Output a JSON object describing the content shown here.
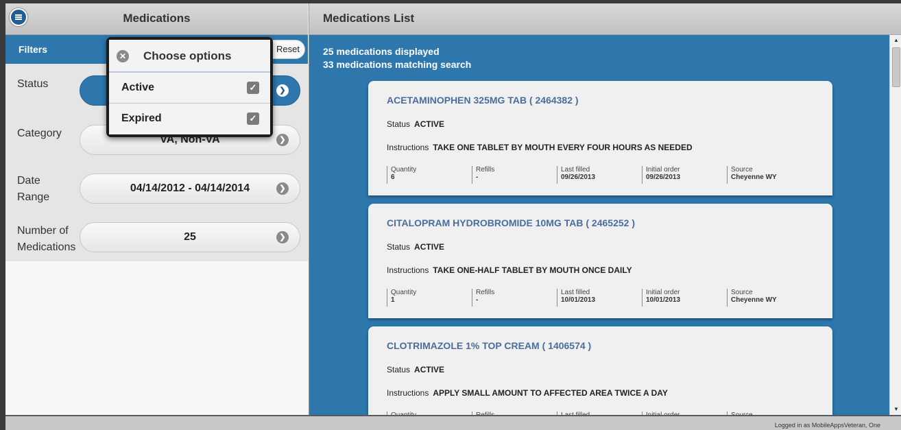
{
  "left_panel": {
    "title": "Medications",
    "filters_label": "Filters",
    "reset_label": "Reset",
    "filters": [
      {
        "label": "Status",
        "value": ""
      },
      {
        "label": "Category",
        "value": "VA, Non-VA"
      },
      {
        "label": "Date Range",
        "value": "04/14/2012 - 04/14/2014"
      },
      {
        "label": "Number of Medications",
        "value": "25"
      }
    ]
  },
  "popup": {
    "title": "Choose options",
    "options": [
      {
        "label": "Active",
        "checked": true
      },
      {
        "label": "Expired",
        "checked": true
      }
    ]
  },
  "right_panel": {
    "title": "Medications List",
    "displayed": "25 medications displayed",
    "matching": "33 medications matching search",
    "cards": [
      {
        "name": "ACETAMINOPHEN 325MG TAB ( 2464382 )",
        "status_label": "Status",
        "status": "ACTIVE",
        "instructions_label": "Instructions",
        "instructions": "TAKE ONE TABLET BY MOUTH EVERY FOUR HOURS AS NEEDED",
        "fields": [
          {
            "label": "Quantity",
            "value": "6"
          },
          {
            "label": "Refills",
            "value": "-"
          },
          {
            "label": "Last filled",
            "value": "09/26/2013"
          },
          {
            "label": "Initial order",
            "value": "09/26/2013"
          },
          {
            "label": "Source",
            "value": "Cheyenne WY"
          }
        ]
      },
      {
        "name": "CITALOPRAM HYDROBROMIDE 10MG TAB ( 2465252 )",
        "status_label": "Status",
        "status": "ACTIVE",
        "instructions_label": "Instructions",
        "instructions": "TAKE ONE-HALF TABLET BY MOUTH ONCE DAILY",
        "fields": [
          {
            "label": "Quantity",
            "value": "1"
          },
          {
            "label": "Refills",
            "value": "-"
          },
          {
            "label": "Last filled",
            "value": "10/01/2013"
          },
          {
            "label": "Initial order",
            "value": "10/01/2013"
          },
          {
            "label": "Source",
            "value": "Cheyenne WY"
          }
        ]
      },
      {
        "name": "CLOTRIMAZOLE 1% TOP CREAM ( 1406574 )",
        "status_label": "Status",
        "status": "ACTIVE",
        "instructions_label": "Instructions",
        "instructions": "APPLY SMALL AMOUNT TO AFFECTED AREA TWICE A DAY",
        "fields": [
          {
            "label": "Quantity",
            "value": ""
          },
          {
            "label": "Refills",
            "value": ""
          },
          {
            "label": "Last filled",
            "value": ""
          },
          {
            "label": "Initial order",
            "value": ""
          },
          {
            "label": "Source",
            "value": ""
          }
        ]
      }
    ]
  },
  "footer": {
    "text": "Logged in as MobileAppsVeteran, One"
  },
  "colors": {
    "accent": "#2e77ad",
    "header": "#c8c8c8",
    "link": "#4a6d9c"
  },
  "icons": {
    "menu": "menu-icon",
    "chevron": "chevron-down-icon",
    "close": "close-icon",
    "check": "checkbox-checked-icon"
  }
}
